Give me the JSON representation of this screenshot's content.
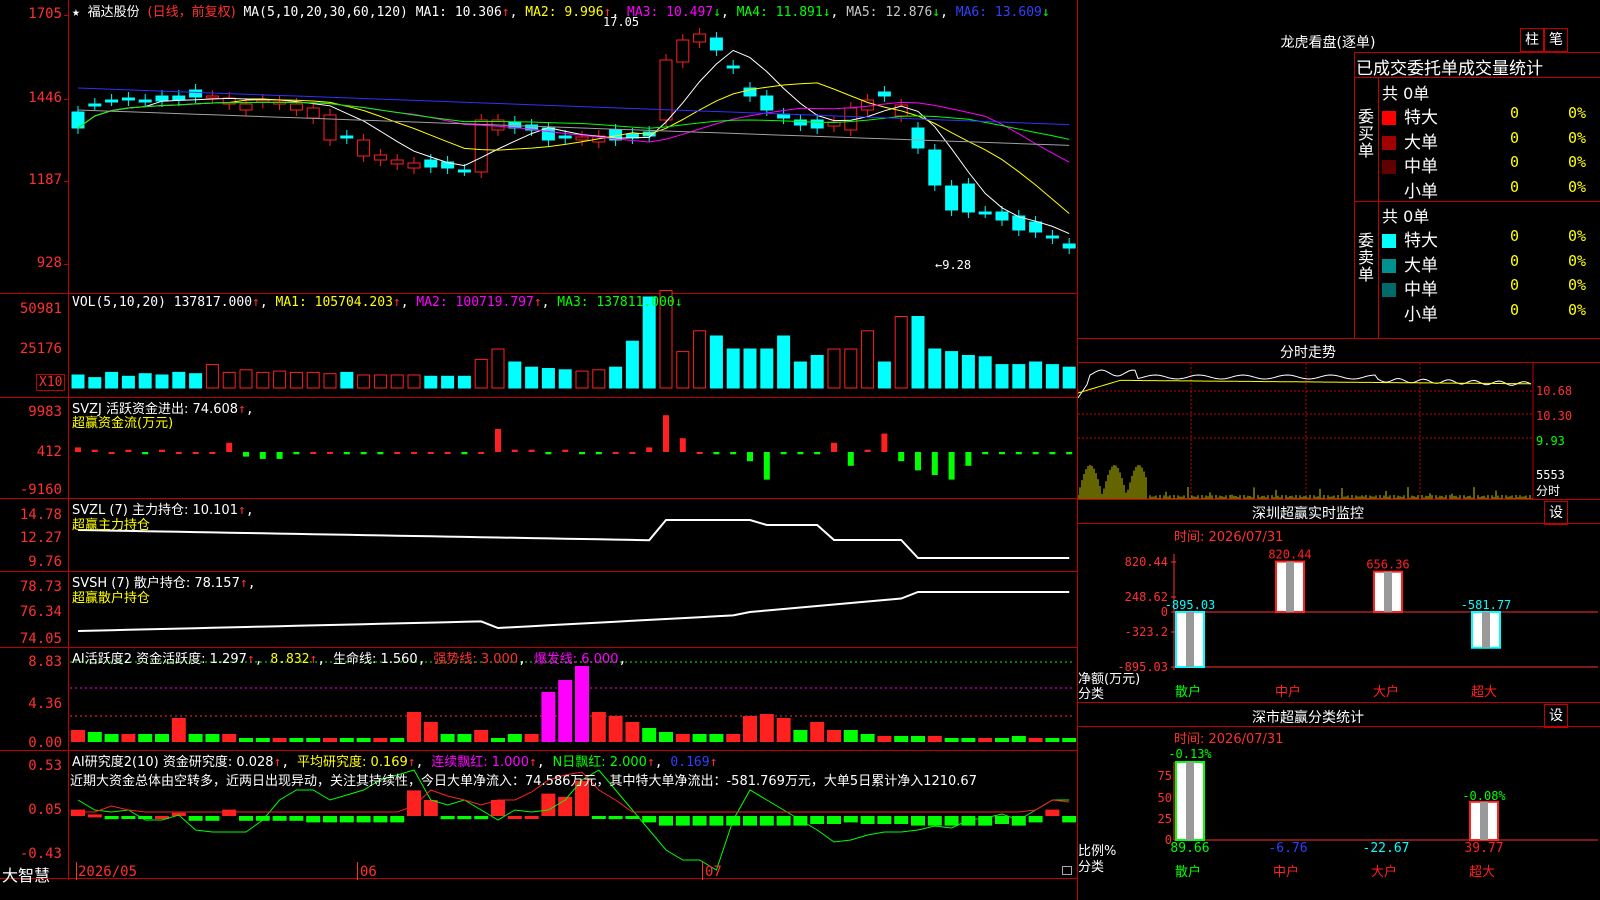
{
  "main": {
    "header": {
      "star": "★",
      "stock_name": "福达股份",
      "period": "(日线，前复权)",
      "ma_def": "MA(5,10,20,30,60,120)",
      "ma1": "MA1: 10.306",
      "ma2": "MA2: 9.996",
      "ma3": "MA3: 10.497",
      "ma4": "MA4: 11.891",
      "ma5": "MA5: 12.876",
      "ma6": "MA6: 13.609",
      "up": "↑",
      "down": "↓"
    },
    "y_labels": [
      "1705",
      "1446",
      "1187",
      "928"
    ],
    "high_mark": "17.05",
    "low_mark": "←9.28",
    "colors": {
      "up": "#ff2020",
      "down": "#00ffff",
      "ma1": "#ffffff",
      "ma2": "#ffff00",
      "ma3": "#ff00ff",
      "ma4": "#00ff00",
      "ma5": "#a0a0a0",
      "ma6": "#3030ff"
    }
  },
  "volume": {
    "header": {
      "def": "VOL(5,10,20)",
      "value": "137817.000",
      "ma1": "MA1: 105704.203",
      "ma2": "MA2: 100719.797",
      "ma3": "MA3: 137811.000"
    },
    "y_labels": [
      "50981",
      "25176"
    ],
    "unit": "X10"
  },
  "svzj": {
    "header": {
      "title": "SVZJ  活跃资金进出: 74.608",
      "sub": "超赢资金流(万元)"
    },
    "y_labels": [
      "9983",
      "412",
      "-9160"
    ]
  },
  "svzl": {
    "header": {
      "title": "SVZL (7) 主力持仓: 10.101",
      "sub": "超赢主力持仓"
    },
    "y_labels": [
      "14.78",
      "12.27",
      "9.76"
    ]
  },
  "svsh": {
    "header": {
      "title": "SVSH (7) 散户持仓: 78.157",
      "sub": "超赢散户持仓"
    },
    "y_labels": [
      "78.73",
      "76.34",
      "74.05"
    ]
  },
  "ai_active": {
    "header": {
      "title": "AI活跃度2 资金活跃度: 1.297",
      "v2": "8.832",
      "life": "生命线: 1.560",
      "strong": "强势线: 3.000",
      "burst": "爆发线: 6.000"
    },
    "y_labels": [
      "8.83",
      "4.36",
      "0.00"
    ]
  },
  "ai_research": {
    "header": {
      "title": "AI研究度2(10) 资金研究度: 0.028",
      "avg": "平均研究度: 0.169",
      "consec": "连续飘红: 1.000",
      "nday": "N日飘红: 2.000",
      "last": "0.169"
    },
    "comment": "近期大资金总体由空转多，近两日出现异动，关注其持续性，今日大单净流入：74.586万元，其中特大单净流出：-581.769万元，大单5日累计净入1210.67",
    "y_labels": [
      "0.53",
      "0.05",
      "-0.43"
    ]
  },
  "bottom": {
    "brand": "大智慧",
    "dates": [
      "2026/05",
      "06",
      "07"
    ]
  },
  "right": {
    "top_title": "龙虎看盘(逐单)",
    "btn_zhu": "柱",
    "btn_bi": "笔",
    "tabs_title": "已成交委托单成交量统计",
    "buy_label": "委买单",
    "sell_label": "委卖单",
    "buy_total": "共 0单",
    "sell_total": "共 0单",
    "buy_rows": [
      {
        "name": "特大",
        "count": "0",
        "pct": "0%",
        "color": "#ff0000"
      },
      {
        "name": "大单",
        "count": "0",
        "pct": "0%",
        "color": "#a00000"
      },
      {
        "name": "中单",
        "count": "0",
        "pct": "0%",
        "color": "#600000"
      },
      {
        "name": "小单",
        "count": "0",
        "pct": "0%",
        "color": "#000000"
      }
    ],
    "sell_rows": [
      {
        "name": "特大",
        "count": "0",
        "pct": "0%",
        "color": "#00ffff"
      },
      {
        "name": "大单",
        "count": "0",
        "pct": "0%",
        "color": "#009090"
      },
      {
        "name": "中单",
        "count": "0",
        "pct": "0%",
        "color": "#006a6a"
      },
      {
        "name": "小单",
        "count": "0",
        "pct": "0%",
        "color": "#000000"
      }
    ],
    "intraday_title": "分时走势",
    "intraday_labels": [
      "10.68",
      "10.30",
      "9.93",
      "5553",
      "分时"
    ],
    "monitor_title": "深圳超赢实时监控",
    "monitor_btn": "设",
    "monitor_time": "时间: 2026/07/31",
    "monitor_y": [
      "820.44",
      "248.62",
      "0",
      "-323.2",
      "-895.03"
    ],
    "monitor_unit": "净额(万元)",
    "monitor_cat_label": "分类",
    "monitor_categories": [
      "散户",
      "中户",
      "大户",
      "超大"
    ],
    "monitor_values": [
      -895.03,
      820.44,
      656.36,
      -581.77
    ],
    "monitor_value_labels": [
      "-895.03",
      "820.44",
      "656.36",
      "-581.77"
    ],
    "stat_title": "深市超赢分类统计",
    "stat_btn": "设",
    "stat_time": "时间: 2026/07/31",
    "stat_y": [
      "75",
      "50",
      "25",
      "0"
    ],
    "stat_unit": "比例%",
    "stat_cat_label": "分类",
    "stat_top_labels": [
      "-0.13%",
      "-0.08%"
    ],
    "stat_values": [
      "89.66",
      "-6.76",
      "-22.67",
      "39.77"
    ],
    "stat_categories": [
      "散户",
      "中户",
      "大户",
      "超大"
    ]
  }
}
